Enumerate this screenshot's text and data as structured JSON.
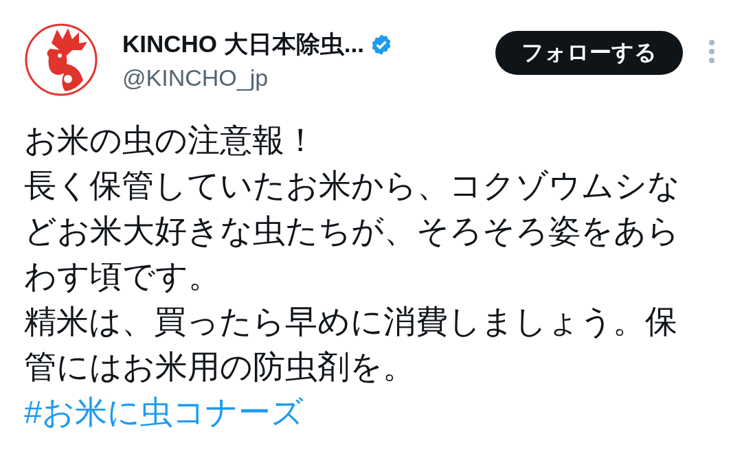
{
  "author": {
    "name": "KINCHO 大日本除虫...",
    "verified": true,
    "handle": "@KINCHO_jp"
  },
  "follow_button": {
    "label": "フォローする"
  },
  "body": {
    "lines": [
      "お米の虫の注意報！",
      "長く保管していたお米から、コクゾウムシな",
      "どお米大好きな虫たちが、そろそろ姿をあら",
      "わす頃です。",
      "精米は、買ったら早めに消費しましょう。保",
      "管にはお米用の防虫剤を。"
    ],
    "hashtag": "#お米に虫コナーズ"
  }
}
